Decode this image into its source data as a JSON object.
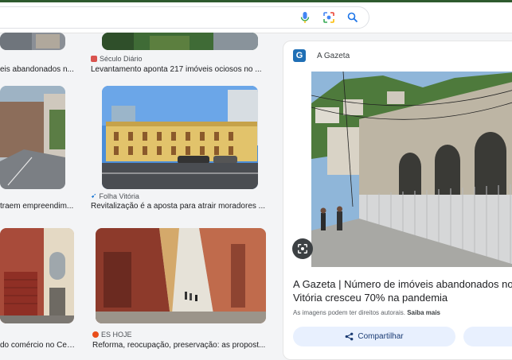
{
  "search": {
    "placeholder": "",
    "icons": [
      "mic-icon",
      "lens-icon",
      "search-icon"
    ]
  },
  "results": [
    {
      "source": "",
      "title": "eis abandonados n..."
    },
    {
      "source": "Século Diário",
      "title": "Levantamento aponta 217 imóveis ociosos no ..."
    },
    {
      "source": "",
      "title": "traem empreendim..."
    },
    {
      "source": "Folha Vitória",
      "title": "Revitalização é a aposta para atrair moradores ..."
    },
    {
      "source": "",
      "title": "do comércio no Cen..."
    },
    {
      "source": "ES HOJE",
      "title": "Reforma, reocupação, preservação: as propost..."
    }
  ],
  "panel": {
    "source_name": "A Gazeta",
    "logo_letter": "G",
    "title": "A Gazeta | Número de imóveis abandonados no Vitória cresceu 70% na pandemia",
    "rights_text": "As imagens podem ter direitos autorais.",
    "learn_more": "Saiba mais",
    "share_label": "Compartilhar"
  },
  "colors": {
    "accent": "#1a73e8",
    "share_bg": "#e8f0fe",
    "brand_gazeta": "#1f6fb5"
  }
}
